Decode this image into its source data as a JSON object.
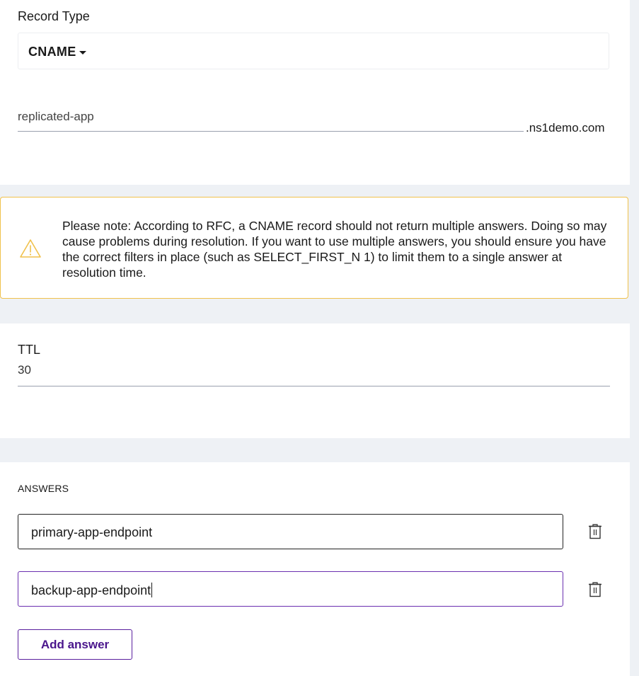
{
  "record_type": {
    "label": "Record Type",
    "selected": "CNAME"
  },
  "hostname": {
    "value": "replicated-app",
    "domain_suffix": ".ns1demo.com"
  },
  "warning": {
    "icon": "warning-triangle-icon",
    "color": "#f0c14b",
    "message": "Please note: According to RFC, a CNAME record should not return multiple answers. Doing so may cause problems during resolution. If you want to use multiple answers, you should ensure you have the correct filters in place (such as SELECT_FIRST_N 1) to limit them to a single answer at resolution time."
  },
  "ttl": {
    "label": "TTL",
    "value": "30"
  },
  "answers": {
    "heading": "ANSWERS",
    "items": [
      {
        "value": "primary-app-endpoint",
        "delete_icon": "trash-icon"
      },
      {
        "value": "backup-app-endpoint",
        "delete_icon": "trash-icon",
        "focused": true
      }
    ],
    "add_button_label": "Add answer",
    "accent_color": "#5a1f9e"
  }
}
